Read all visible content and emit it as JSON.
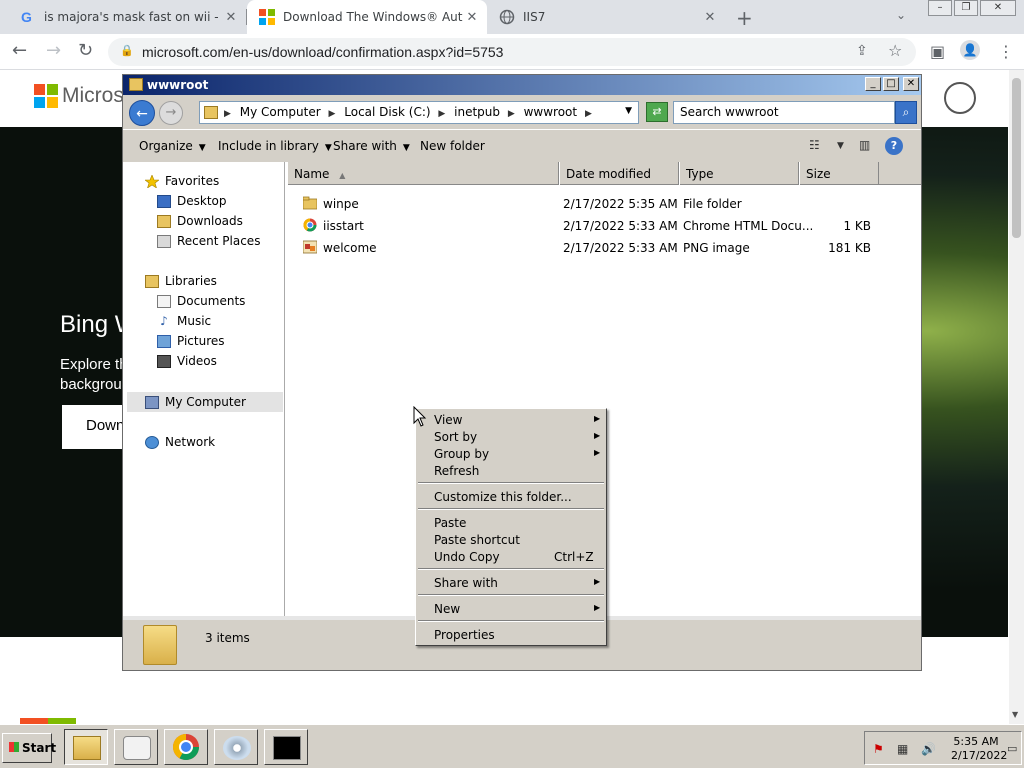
{
  "browser": {
    "tabs": [
      {
        "title": "is majora's mask fast on wii - Google",
        "favicon": "google-icon",
        "active": false
      },
      {
        "title": "Download The Windows® Automati",
        "favicon": "microsoft-icon",
        "active": true
      },
      {
        "title": "IIS7",
        "favicon": "globe-icon",
        "active": false
      }
    ],
    "url": "microsoft.com/en-us/download/confirmation.aspx?id=5753"
  },
  "webpage": {
    "brand": "Microsoft",
    "hero_title": "Bing W",
    "hero_sub_line1": "Explore th",
    "hero_sub_line2": "backgrou",
    "hero_button": "Down"
  },
  "explorer": {
    "title": "wwwroot",
    "breadcrumbs": [
      "My Computer",
      "Local Disk (C:)",
      "inetpub",
      "wwwroot"
    ],
    "search_placeholder": "Search wwwroot",
    "toolbar": {
      "organize": "Organize",
      "include_in_library": "Include in library",
      "share_with": "Share with",
      "new_folder": "New folder"
    },
    "nav": {
      "favorites": "Favorites",
      "desktop": "Desktop",
      "downloads": "Downloads",
      "recent_places": "Recent Places",
      "libraries": "Libraries",
      "documents": "Documents",
      "music": "Music",
      "pictures": "Pictures",
      "videos": "Videos",
      "my_computer": "My Computer",
      "network": "Network"
    },
    "columns": {
      "name": "Name",
      "date_modified": "Date modified",
      "type": "Type",
      "size": "Size"
    },
    "files": [
      {
        "name": "winpe",
        "date": "2/17/2022 5:35 AM",
        "type": "File folder",
        "size": ""
      },
      {
        "name": "iisstart",
        "date": "2/17/2022 5:33 AM",
        "type": "Chrome HTML Docu...",
        "size": "1 KB"
      },
      {
        "name": "welcome",
        "date": "2/17/2022 5:33 AM",
        "type": "PNG image",
        "size": "181 KB"
      }
    ],
    "status_count": "3 items"
  },
  "context_menu": {
    "view": "View",
    "sort_by": "Sort by",
    "group_by": "Group by",
    "refresh": "Refresh",
    "customize": "Customize this folder...",
    "paste": "Paste",
    "paste_shortcut": "Paste shortcut",
    "undo_copy": "Undo Copy",
    "undo_shortcut": "Ctrl+Z",
    "share_with": "Share with",
    "new": "New",
    "properties": "Properties"
  },
  "taskbar": {
    "start": "Start",
    "time": "5:35 AM",
    "date": "2/17/2022"
  },
  "colors": {
    "title_bar_start": "#0a246a",
    "title_bar_end": "#a6caf0",
    "classic_face": "#d4d0c8"
  }
}
